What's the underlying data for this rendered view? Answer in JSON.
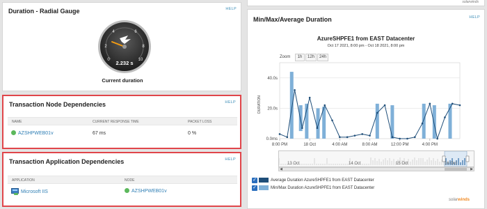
{
  "gauge_panel": {
    "title": "Duration - Radial Gauge",
    "help": "HELP",
    "scale": [
      "0",
      "2",
      "4",
      "6",
      "8",
      "10"
    ],
    "value": "2.232 s",
    "caption": "Current duration"
  },
  "node_panel": {
    "title": "Transaction Node Dependencies",
    "help": "HELP",
    "headers": [
      "NAME",
      "CURRENT RESPONSE TIME",
      "PACKET LOSS"
    ],
    "row": {
      "name": "AZSHPWEB01v",
      "response": "67 ms",
      "loss": "0 %"
    }
  },
  "app_panel": {
    "title": "Transaction Application Dependencies",
    "help": "HELP",
    "headers": [
      "APPLICATION",
      "NODE"
    ],
    "row": {
      "application": "Microsoft IIS",
      "node": "AZSHPWEB01v"
    }
  },
  "chart_panel": {
    "title": "Min/Max/Average Duration",
    "help": "HELP",
    "top_logo": "solarwinds",
    "zoom_label": "Zoom",
    "zoom_options": [
      "1h",
      "12h",
      "24h"
    ],
    "logo_prefix": "solar",
    "logo_suffix": "winds"
  },
  "chart_data": {
    "type": "bar",
    "title": "AzureSHPFE1 from EAST Datacenter",
    "subtitle": "Oct 17 2021, 8:00 pm - Oct 18 2021, 8:00 pm",
    "ylabel": "DURATION",
    "ylim": [
      0,
      50
    ],
    "yticks": [
      "0.0ms",
      "20.0s",
      "40.0s"
    ],
    "xticks": [
      "8:00 PM",
      "18 Oct",
      "4:00 AM",
      "8:00 AM",
      "12:00 PM",
      "4:00 PM"
    ],
    "navigator_labels": [
      "13 Oct",
      "14 Oct",
      "15 Oct",
      "16 Oct"
    ],
    "x": [
      20,
      21,
      22,
      23,
      24,
      25,
      26,
      27,
      28,
      29,
      30,
      31,
      32,
      33,
      34,
      35,
      36,
      37,
      38,
      39,
      40,
      41,
      42,
      43,
      44
    ],
    "series": [
      {
        "name": "Average Duration AzureSHPFE1 from EAST Datacenter",
        "color": "#1f4e79",
        "values": [
          3,
          1,
          32,
          7,
          27,
          7,
          22,
          12,
          1,
          1,
          2,
          3,
          2,
          17,
          22,
          1,
          0,
          0,
          1,
          10,
          23,
          0,
          14,
          23,
          22
        ]
      },
      {
        "name": "Min/Max Duration AzureSHPFE1 from EAST Datacenter",
        "color": "#7fb0d8",
        "bars": [
          {
            "x": 21.6,
            "min": 0,
            "max": 44
          },
          {
            "x": 22.8,
            "min": 5,
            "max": 22
          },
          {
            "x": 23.6,
            "min": 0,
            "max": 23
          },
          {
            "x": 25.1,
            "min": 0,
            "max": 20
          },
          {
            "x": 25.9,
            "min": 0,
            "max": 21
          },
          {
            "x": 33.0,
            "min": 0,
            "max": 23
          },
          {
            "x": 35.0,
            "min": 0,
            "max": 22
          },
          {
            "x": 39.2,
            "min": 0,
            "max": 23
          },
          {
            "x": 40.6,
            "min": 0,
            "max": 22
          },
          {
            "x": 42.7,
            "min": 0,
            "max": 23
          }
        ]
      }
    ]
  }
}
